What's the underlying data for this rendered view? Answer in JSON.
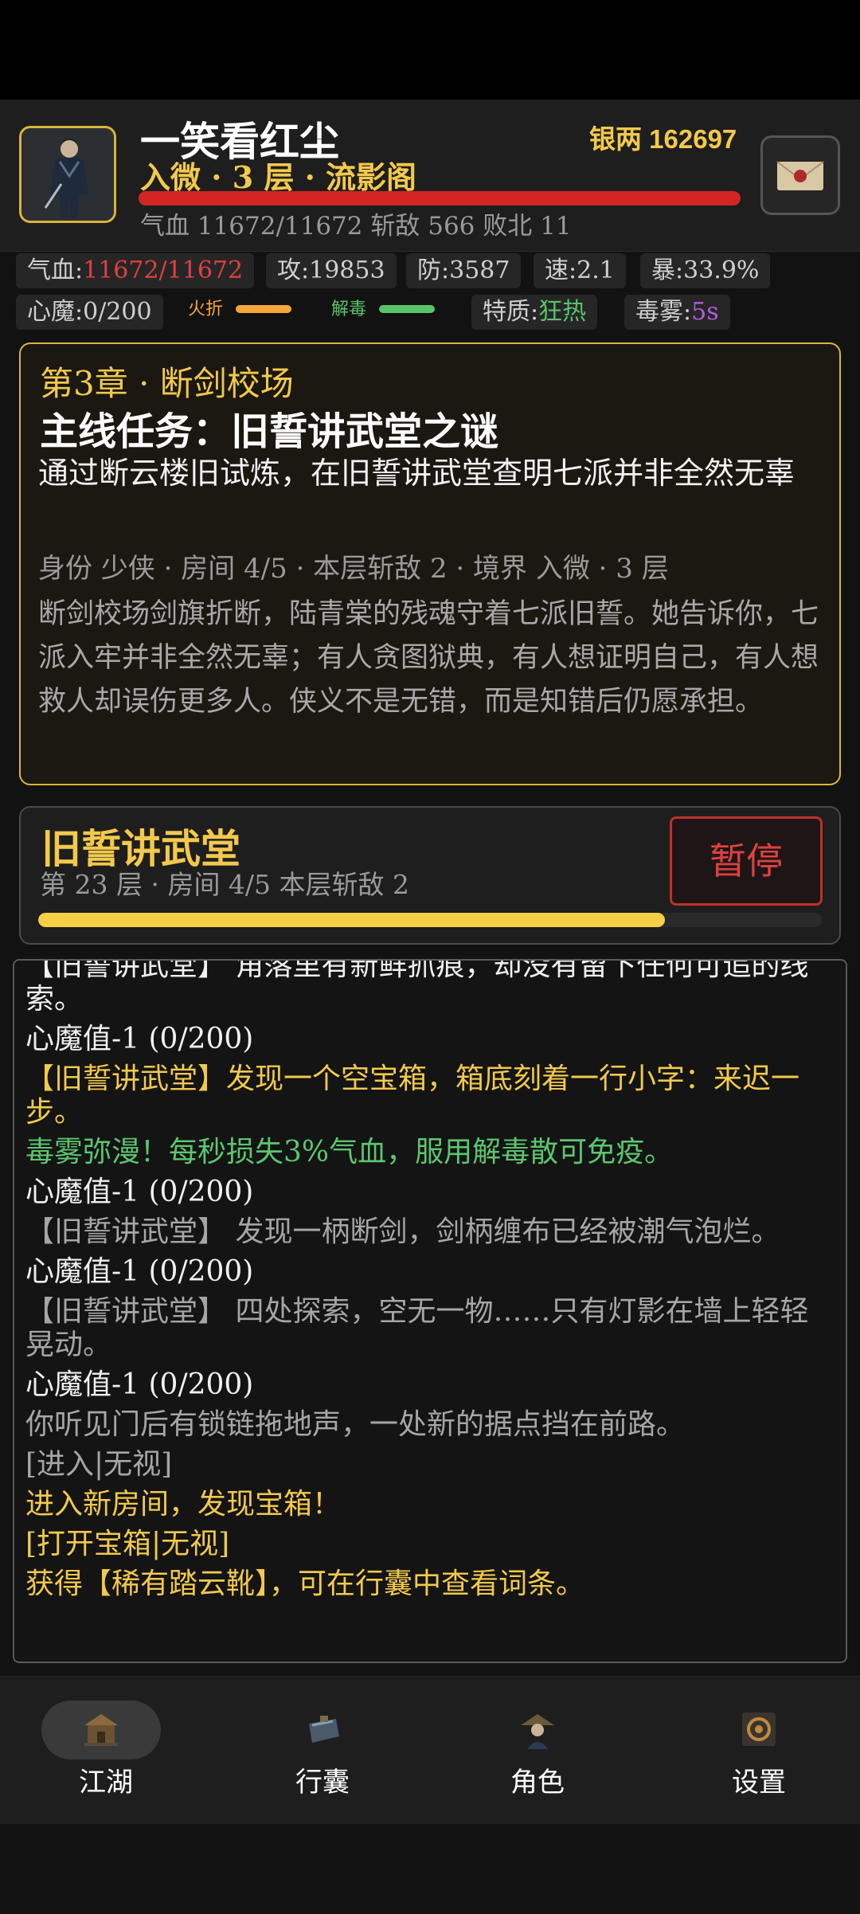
{
  "player": {
    "name": "一笑看红尘",
    "silver_text": "银两 162697",
    "realm_text": "入微 · 3 层 · 流影阁",
    "hp_fraction": 1.0,
    "summary_text": "气血 11672/11672  斩敌 566  败北 11"
  },
  "stats": {
    "hp_label": "气血:",
    "hp_value": "11672/11672",
    "attack": "攻:19853",
    "defense": "防:3587",
    "speed": "速:2.1",
    "crit": "暴:33.9%",
    "heart_demon": "心魔:0/200",
    "fire_label": "火折",
    "antidote_label": "解毒",
    "trait_label": "特质:",
    "trait_value": "狂热",
    "poison_label": "毒雾:",
    "poison_value": "5s",
    "fire_fraction": 0.9,
    "antidote_fraction": 0.9
  },
  "quest": {
    "chapter": "第3章 · 断剑校场",
    "title": "主线任务：旧誓讲武堂之谜",
    "description": "通过断云楼旧试炼，在旧誓讲武堂查明七派并非全然无辜",
    "meta": "身份 少侠 · 房间 4/5 · 本层斩敌 2 · 境界 入微 · 3 层",
    "story": "断剑校场剑旗折断，陆青棠的残魂守着七派旧誓。她告诉你，七派入牢并非全然无辜；有人贪图狱典，有人想证明自己，有人想救人却误伤更多人。侠义不是无错，而是知错后仍愿承担。"
  },
  "room": {
    "title": "旧誓讲武堂",
    "subtitle": "第 23 层 · 房间 4/5  本层斩敌 2",
    "pause_label": "暂停",
    "progress_fraction": 0.8
  },
  "log": [
    {
      "text": "【旧誓讲武堂】 角落里有新鲜抓痕，却没有留下任何可追的线索。",
      "color": "white"
    },
    {
      "text": "心魔值-1 (0/200)",
      "color": "white"
    },
    {
      "text": "【旧誓讲武堂】发现一个空宝箱，箱底刻着一行小字：来迟一步。",
      "color": "gold"
    },
    {
      "text": "毒雾弥漫！每秒损失3%气血，服用解毒散可免疫。",
      "color": "green"
    },
    {
      "text": "心魔值-1 (0/200)",
      "color": "white"
    },
    {
      "text": "【旧誓讲武堂】 发现一柄断剑，剑柄缠布已经被潮气泡烂。",
      "color": "gray"
    },
    {
      "text": "心魔值-1 (0/200)",
      "color": "white"
    },
    {
      "text": "【旧誓讲武堂】 四处探索，空无一物……只有灯影在墙上轻轻晃动。",
      "color": "gray"
    },
    {
      "text": "心魔值-1 (0/200)",
      "color": "white"
    },
    {
      "text": "你听见门后有锁链拖地声，一处新的据点挡在前路。",
      "color": "gray"
    },
    {
      "text": "[进入|无视]",
      "color": "gray"
    },
    {
      "text": "进入新房间，发现宝箱！",
      "color": "gold"
    },
    {
      "text": "[打开宝箱|无视]",
      "color": "gold"
    },
    {
      "text": "获得【稀有踏云靴】，可在行囊中查看词条。",
      "color": "gold"
    }
  ],
  "nav": {
    "items": [
      {
        "label": "江湖",
        "icon": "jianghu-icon",
        "active": true
      },
      {
        "label": "行囊",
        "icon": "bag-icon",
        "active": false
      },
      {
        "label": "角色",
        "icon": "character-icon",
        "active": false
      },
      {
        "label": "设置",
        "icon": "settings-icon",
        "active": false
      }
    ]
  },
  "colors": {
    "gold": "#f2c94c",
    "red": "#d42525",
    "green": "#5cc66f",
    "purple": "#b45ce0"
  }
}
